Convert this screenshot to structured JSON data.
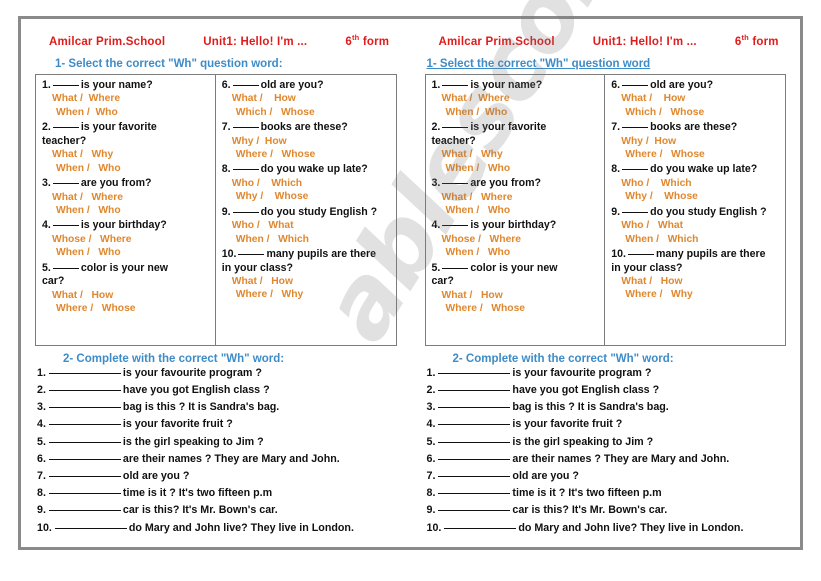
{
  "document": {
    "type": "esl-worksheet",
    "title": "Wh question words worksheet",
    "colors": {
      "header_red": "#e01b1b",
      "heading_blue": "#3d8cc8",
      "option_orange": "#e0882f",
      "body_black": "#111111",
      "frame_gray": "#8a8a8a",
      "box_border": "#7c7c7c"
    },
    "watermark": "ablescom"
  },
  "header": {
    "school": "Amilcar Prim.School",
    "unit": "Unit1: Hello! I'm ...",
    "form_number": "6",
    "form_sup": "th",
    "form_label": "form"
  },
  "section1": {
    "heading_left": "1- Select the correct \"Wh\" question word:",
    "heading_right": "1- Select the correct \"Wh\" question word",
    "questions_left": [
      {
        "num": "1.",
        "text_before": "",
        "text_after": "is your name?",
        "second_line": "",
        "options_line1": "What /  Where",
        "options_line2": "When /  Who"
      },
      {
        "num": "2.",
        "text_before": "",
        "text_after": "is your favorite",
        "second_line": "teacher?",
        "options_line1": "What /   Why",
        "options_line2": "When /   Who"
      },
      {
        "num": "3.",
        "text_before": "",
        "text_after": "are you from?",
        "second_line": "",
        "options_line1": "What /   Where",
        "options_line2": "When /   Who"
      },
      {
        "num": "4.",
        "text_before": "",
        "text_after": "is your birthday?",
        "second_line": "",
        "options_line1": "Whose /   Where",
        "options_line2": "When /   Who"
      },
      {
        "num": "5.",
        "text_before": "",
        "text_after": "color is your new",
        "second_line": "car?",
        "options_line1": "What /   How",
        "options_line2": "Where /   Whose"
      }
    ],
    "questions_right": [
      {
        "num": "6.",
        "text_before": "",
        "text_after": "old are you?",
        "second_line": "",
        "options_line1": "What /    How",
        "options_line2": "Which /   Whose"
      },
      {
        "num": "7.",
        "text_before": "",
        "text_after": "books are these?",
        "second_line": "",
        "options_line1": "Why /  How",
        "options_line2": "Where /   Whose"
      },
      {
        "num": "8.",
        "text_before": "",
        "text_after": "do you wake up late?",
        "second_line": "",
        "options_line1": "Who /    Which",
        "options_line2": "Why /    Whose"
      },
      {
        "num": "9.",
        "text_before": "",
        "text_after": "do you study English ?",
        "second_line": "",
        "options_line1": "Who /   What",
        "options_line2": "When /   Which"
      },
      {
        "num": "10.",
        "text_before": "",
        "text_after": "many pupils are there",
        "second_line": "in your class?",
        "options_line1": "What /   How",
        "options_line2": "Where /   Why"
      }
    ]
  },
  "section2": {
    "heading": "2- Complete with  the correct  \"Wh\"  word:",
    "items": [
      {
        "num": "1.",
        "text": "is your  favourite program ?"
      },
      {
        "num": "2.",
        "text": "have you got English class ?"
      },
      {
        "num": "3.",
        "text": "bag is this ? It is Sandra's bag."
      },
      {
        "num": "4.",
        "text": "is your favorite fruit ?"
      },
      {
        "num": "5.",
        "text": "is the girl speaking to Jim ?"
      },
      {
        "num": "6.",
        "text": "are their names ? They are Mary and John."
      },
      {
        "num": "7.",
        "text": "old are you ?"
      },
      {
        "num": "8.",
        "text": "time is it ? It's  two fifteen  p.m"
      },
      {
        "num": "9.",
        "text": "car is this? It's Mr. Bown's car."
      },
      {
        "num": "10.",
        "text": "do Mary and John live? They live in London."
      }
    ]
  }
}
